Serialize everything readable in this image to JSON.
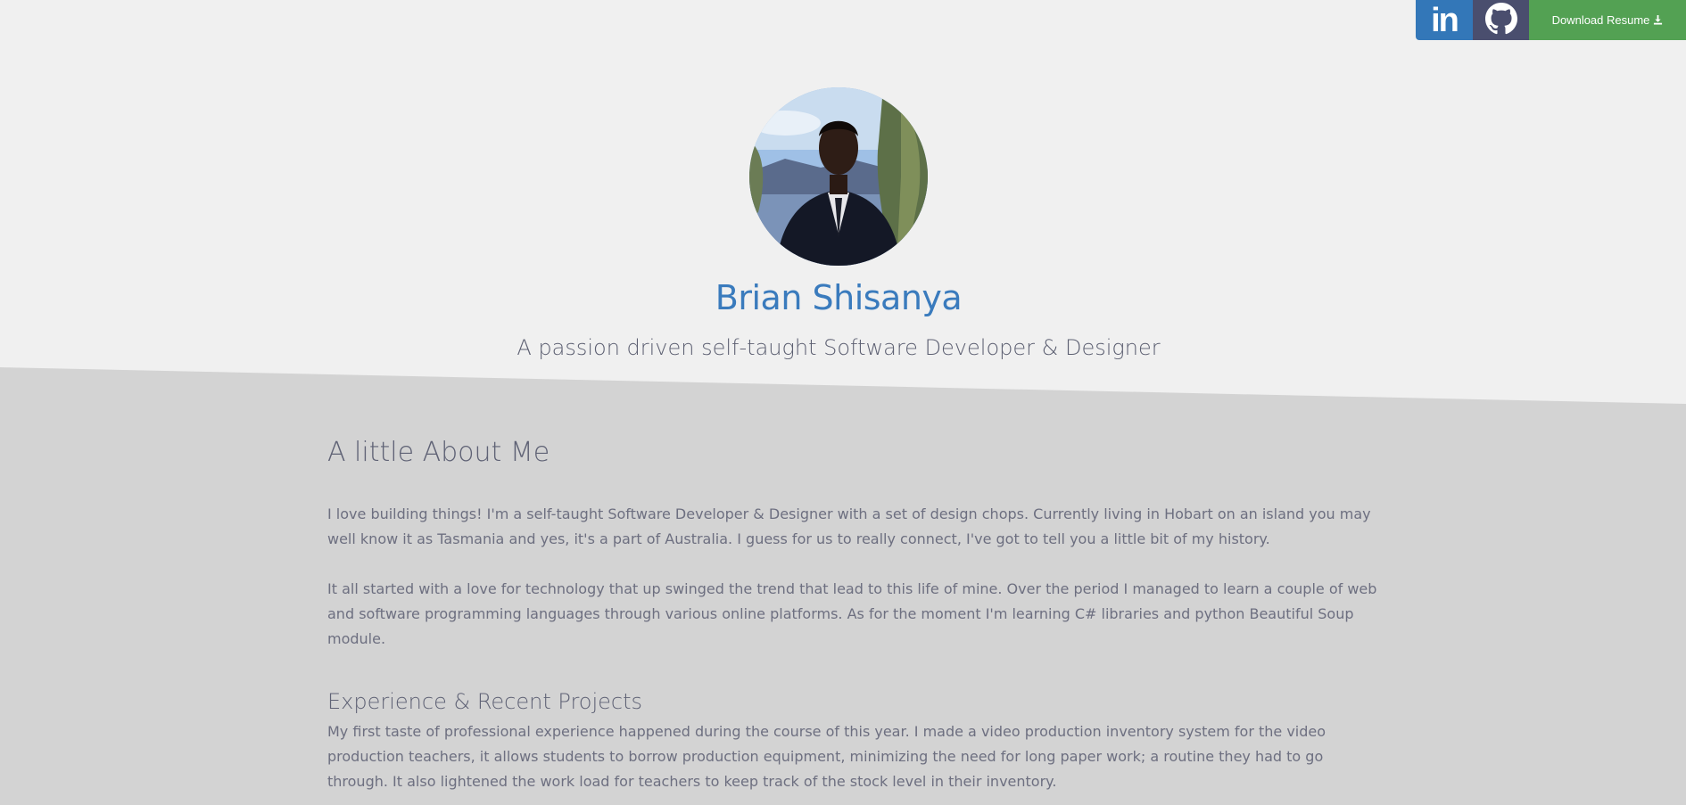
{
  "topbar": {
    "linkedin_label": "in",
    "resume_label": "Download Resume"
  },
  "hero": {
    "name": "Brian Shisanya",
    "tagline": "A passion driven self-taught Software Developer & Designer"
  },
  "about": {
    "title": "A little About Me",
    "paragraphs": [
      "I love building things! I'm a self-taught Software Developer & Designer with a set of design chops. Currently living in Hobart on an island you may well know it as Tasmania and yes, it's a part of Australia. I guess for us to really connect, I've got to tell you a little bit of my history.",
      "It all started with a love for technology that up swinged the trend that lead to this life of mine. Over the period I managed to learn a couple of web and software programming languages through various online platforms. As for the moment I'm learning C# libraries and python Beautiful Soup module."
    ]
  },
  "experience": {
    "title": "Experience & Recent Projects",
    "paragraph": "My first taste of professional experience happened during the course of this year. I made a video production inventory system for the video production teachers, it allows students to borrow production equipment, minimizing the need for long paper work; a routine they had to go through. It also lightened the work load for teachers to keep track of the stock level in their inventory."
  },
  "colors": {
    "linkedin": "#3377b8",
    "github": "#4a4e6e",
    "resume": "#53a153",
    "name": "#3a7bbd",
    "lower_bg": "#d3d3d3",
    "upper_bg": "#f0f0f0"
  },
  "icons": [
    "linkedin-icon",
    "github-icon",
    "download-icon"
  ]
}
